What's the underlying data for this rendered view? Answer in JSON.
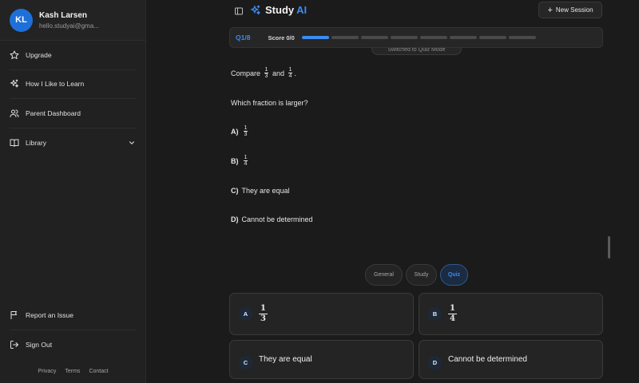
{
  "user": {
    "initials": "KL",
    "name": "Kash Larsen",
    "email": "hello.studyai@gma..."
  },
  "sidebar": {
    "items": [
      {
        "label": "Upgrade",
        "icon": "star-icon"
      },
      {
        "label": "How I Like to Learn",
        "icon": "sparkles-icon"
      },
      {
        "label": "Parent Dashboard",
        "icon": "users-icon"
      },
      {
        "label": "Library",
        "icon": "book-icon"
      }
    ],
    "bottom_items": [
      {
        "label": "Report an Issue",
        "icon": "flag-icon"
      },
      {
        "label": "Sign Out",
        "icon": "sign-out-icon"
      }
    ],
    "footer": {
      "privacy": "Privacy",
      "terms": "Terms",
      "contact": "Contact"
    }
  },
  "header": {
    "brand_study": "Study",
    "brand_ai": "AI",
    "new_session_label": "New Session"
  },
  "quiz": {
    "question_label": "Q1/8",
    "score_label": "Score 0/0",
    "progress": {
      "current": 1,
      "total": 8
    },
    "toast": "Switched to Quiz Mode",
    "prompt_prefix": "Compare",
    "prompt_and": "and",
    "prompt_end": ".",
    "fraction_a": {
      "num": "1",
      "den": "3"
    },
    "fraction_b": {
      "num": "1",
      "den": "4"
    },
    "question": "Which fraction is larger?",
    "options": [
      {
        "letter": "A)",
        "num": "1",
        "den": "3"
      },
      {
        "letter": "B)",
        "num": "1",
        "den": "4"
      },
      {
        "letter": "C)",
        "text": "They are equal"
      },
      {
        "letter": "D)",
        "text": "Cannot be determined"
      }
    ]
  },
  "modes": {
    "general": "General",
    "study": "Study",
    "quiz": "Quiz",
    "active": "Quiz"
  },
  "answers": [
    {
      "letter": "A",
      "num": "1",
      "den": "3"
    },
    {
      "letter": "B",
      "num": "1",
      "den": "4"
    },
    {
      "letter": "C",
      "text": "They are equal"
    },
    {
      "letter": "D",
      "text": "Cannot be determined"
    }
  ],
  "colors": {
    "accent": "#3b8cf0",
    "avatar": "#1e6fd9",
    "background": "#1b1b1b",
    "sidebar": "#212121"
  }
}
